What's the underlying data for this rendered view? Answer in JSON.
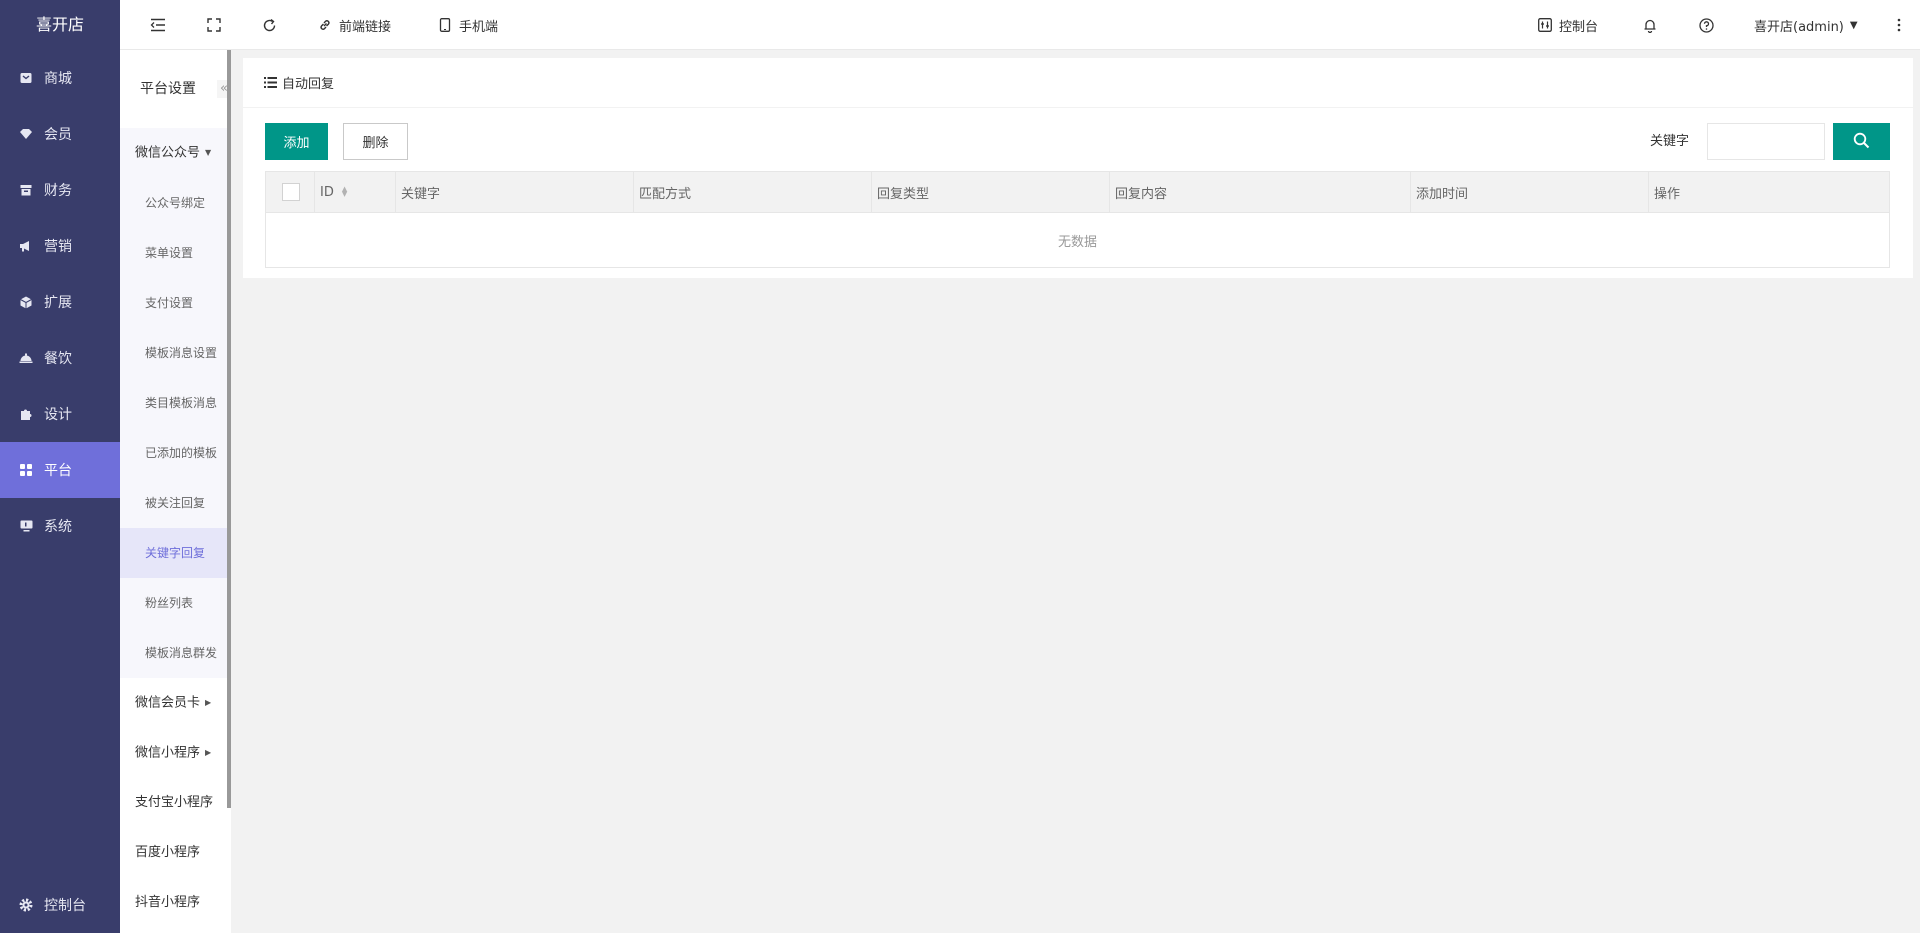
{
  "brand": "喜开店",
  "nav": {
    "items": [
      {
        "label": "商城",
        "icon": "shop-icon"
      },
      {
        "label": "会员",
        "icon": "member-icon"
      },
      {
        "label": "财务",
        "icon": "finance-icon"
      },
      {
        "label": "营销",
        "icon": "megaphone-icon"
      },
      {
        "label": "扩展",
        "icon": "cube-icon"
      },
      {
        "label": "餐饮",
        "icon": "food-cover-icon"
      },
      {
        "label": "设计",
        "icon": "puzzle-icon"
      },
      {
        "label": "平台",
        "icon": "grid-icon",
        "active": true
      },
      {
        "label": "系统",
        "icon": "monitor-icon"
      }
    ],
    "footer": "控制台"
  },
  "side2": {
    "title": "平台设置",
    "collapse": "«",
    "groups": [
      {
        "label": "微信公众号",
        "expanded": true
      },
      {
        "label": "微信会员卡"
      },
      {
        "label": "微信小程序"
      },
      {
        "label": "支付宝小程序"
      },
      {
        "label": "百度小程序"
      },
      {
        "label": "抖音小程序"
      }
    ],
    "subitems": [
      "公众号绑定",
      "菜单设置",
      "支付设置",
      "模板消息设置",
      "类目模板消息",
      "已添加的模板",
      "被关注回复",
      "关键字回复",
      "粉丝列表",
      "模板消息群发"
    ],
    "active_sub": "关键字回复"
  },
  "topbar": {
    "front_link": "前端链接",
    "mobile": "手机端",
    "console": "控制台",
    "user": "喜开店(admin)"
  },
  "card": {
    "title": "自动回复",
    "add": "添加",
    "delete": "删除",
    "keyword_label": "关键字",
    "keyword_value": "",
    "columns": [
      "ID",
      "关键字",
      "匹配方式",
      "回复类型",
      "回复内容",
      "添加时间",
      "操作"
    ],
    "empty": "无数据"
  },
  "colors": {
    "sidebar": "#393d6b",
    "active": "#6f6fda",
    "primary": "#009688"
  }
}
